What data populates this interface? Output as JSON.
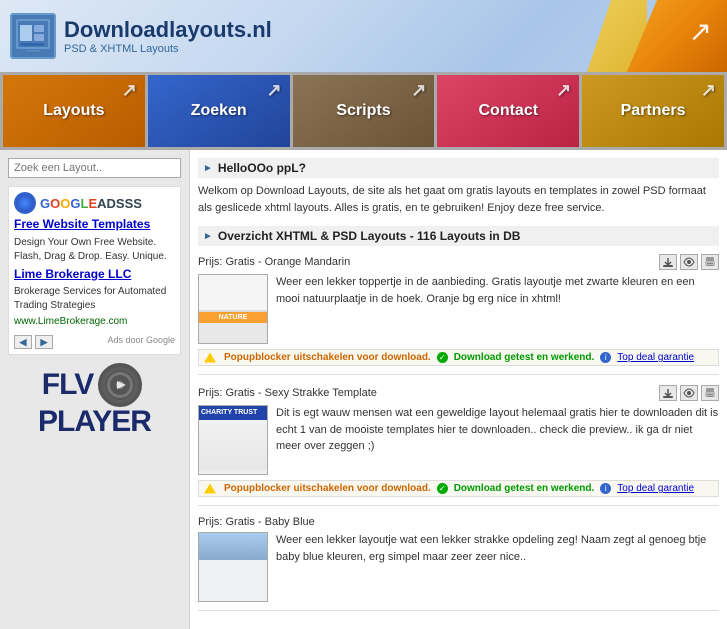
{
  "header": {
    "title": "Downloadlayouts.nl",
    "subtitle": "PSD & XHTML Layouts",
    "icon_label": "layout-icon"
  },
  "nav": {
    "items": [
      {
        "id": "layouts",
        "label": "Layouts",
        "class": "nav-layouts"
      },
      {
        "id": "zoeken",
        "label": "Zoeken",
        "class": "nav-zoeken"
      },
      {
        "id": "scripts",
        "label": "Scripts",
        "class": "nav-scripts"
      },
      {
        "id": "contact",
        "label": "Contact",
        "class": "nav-contact"
      },
      {
        "id": "partners",
        "label": "Partners",
        "class": "nav-partners"
      }
    ]
  },
  "sidebar": {
    "search_placeholder": "Zoek een Layout..",
    "google_ads_label": "GOOGLEADSSS",
    "ad1": {
      "title": "Free Website Templates",
      "text": "Design Your Own Free Website. Flash, Drag & Drop. Easy. Unique.",
      "url": ""
    },
    "ad2": {
      "title": "Lime Brokerage LLC",
      "text": "Brokerage Services for Automated Trading Strategies",
      "url": "www.LimeBrokerage.com"
    },
    "ads_by": "Ads door Google",
    "flv": "FLV",
    "player": "PLAYER"
  },
  "content": {
    "hello_header": "HelloOOo ppL?",
    "hello_text": "Welkom op Download Layouts, de site als het gaat om gratis layouts en templates in zowel PSD formaat als geslicede xhtml layouts. Alles is gratis, en te gebruiken! Enjoy deze free service.",
    "overview_header": "Overzicht XHTML & PSD Layouts - 116 Layouts in DB",
    "layouts": [
      {
        "id": "orange-mandarin",
        "price": "Prijs: Gratis - Orange Mandarin",
        "description": "Weer een lekker toppertje in de aanbieding. Gratis layoutje met zwarte kleuren en een mooi natuurplaatje in de hoek. Oranje bg erg nice in xhtml!",
        "status_popupblocker": "Popupblocker uitschakelen voor download.",
        "status_download": "Download getest en werkend.",
        "status_guarantee": "Top deal garantie",
        "thumb_type": "orange"
      },
      {
        "id": "sexy-strakke",
        "price": "Prijs: Gratis - Sexy Strakke Template",
        "description": "Dit is egt wauw mensen wat een geweldige layout helemaal gratis hier te downloaden dit is echt 1 van de mooiste templates hier te downloaden.. check die preview.. ik ga dr niet meer over zeggen ;)",
        "status_popupblocker": "Popupblocker uitschakelen voor download.",
        "status_download": "Download getest en werkend.",
        "status_guarantee": "Top deal garantie",
        "thumb_type": "charity"
      },
      {
        "id": "baby-blue",
        "price": "Prijs: Gratis - Baby Blue",
        "description": "Weer een lekker layoutje wat een lekker strakke opdeling zeg! Naam zegt al genoeg btje baby blue kleuren, erg simpel maar zeer zeer nice..",
        "status_popupblocker": "",
        "status_download": "",
        "status_guarantee": "",
        "thumb_type": "blue"
      }
    ]
  },
  "colors": {
    "nav_layouts": "#d4770a",
    "nav_zoeken": "#3366cc",
    "nav_scripts": "#8b7355",
    "nav_contact": "#dd4466",
    "nav_partners": "#cc9922",
    "header_title": "#1a3a6b",
    "link": "#0000cc",
    "green": "#009900"
  }
}
